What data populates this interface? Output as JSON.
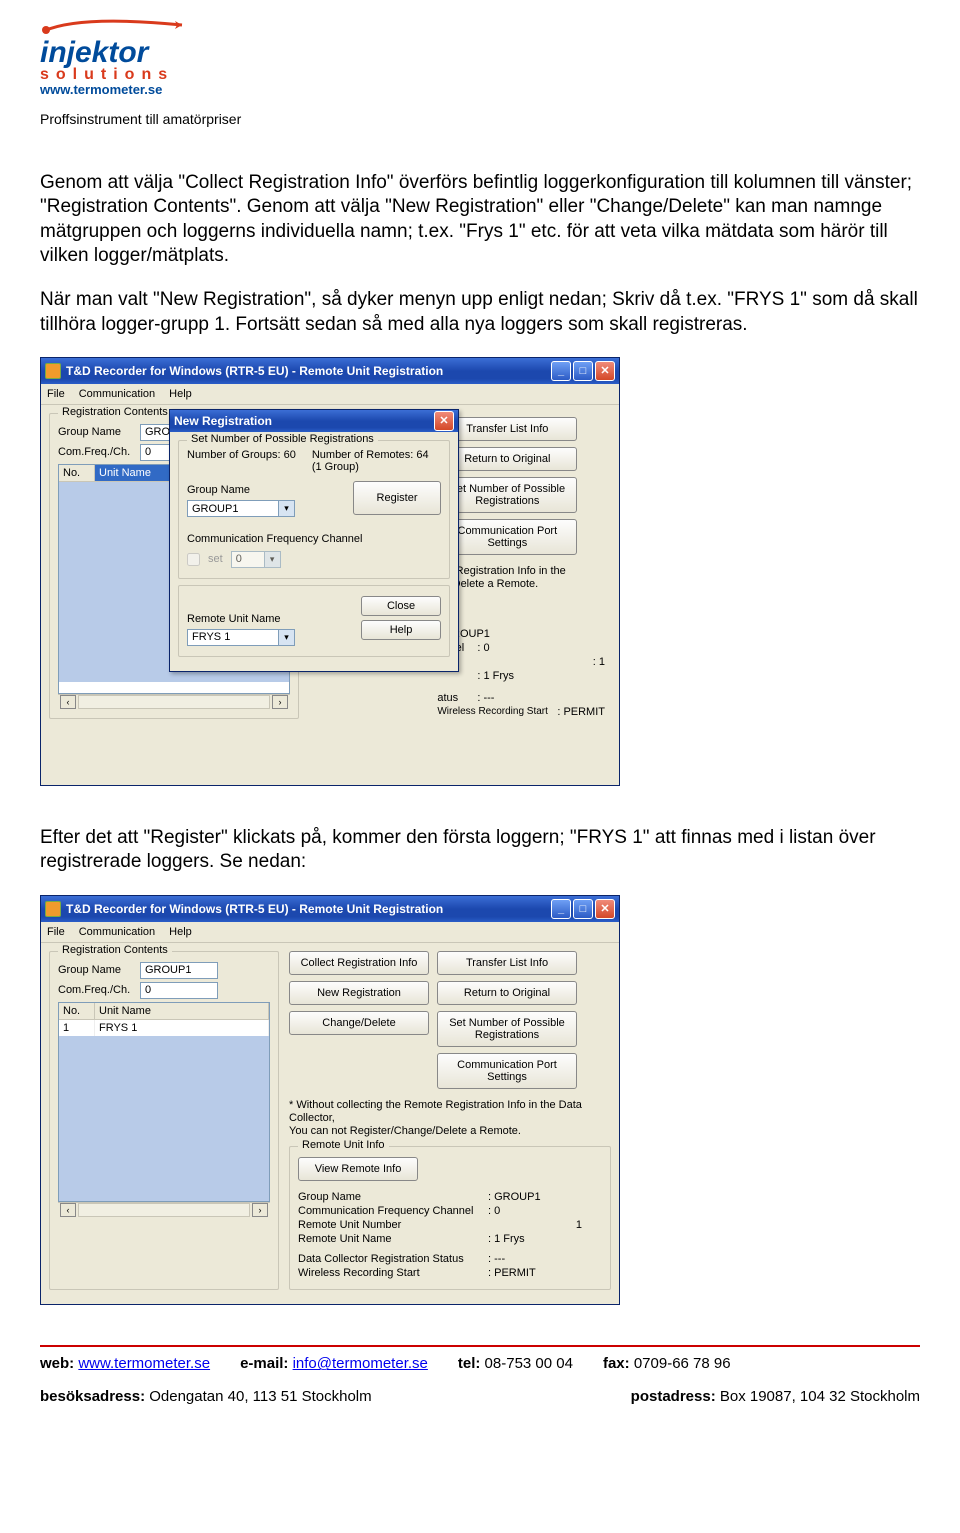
{
  "header": {
    "brand_main": "injektor",
    "brand_sub": "solutions",
    "brand_web": "www.termometer.se",
    "tagline": "Proffsinstrument till amatörpriser"
  },
  "paragraph1": "Genom att välja \"Collect Registration Info\" överförs befintlig loggerkonfiguration till kolumnen till vänster; \"Registration Contents\". Genom att välja \"New Registration\" eller \"Change/Delete\" kan man namnge mätgruppen och loggerns individuella namn; t.ex. \"Frys 1\" etc. för att veta vilka mätdata som härör till vilken logger/mätplats.",
  "paragraph2": "När man valt \"New Registration\", så dyker menyn upp enligt nedan; Skriv då t.ex. \"FRYS 1\" som då skall tillhöra logger-grupp 1. Fortsätt sedan så med alla nya loggers som skall registreras.",
  "paragraph3": "Efter det att \"Register\" klickats på, kommer den första loggern; \"FRYS 1\" att finnas med i listan över registrerade loggers. Se nedan:",
  "win": {
    "title": "T&D Recorder for Windows (RTR-5 EU) - Remote Unit Registration",
    "menu": {
      "file": "File",
      "comm": "Communication",
      "help": "Help"
    },
    "reg_contents": {
      "legend": "Registration Contents",
      "group_name_lbl": "Group Name",
      "group_name_val": "GROUP1",
      "com_freq_lbl": "Com.Freq./Ch.",
      "com_freq_val": "0",
      "col_no": "No.",
      "col_unit": "Unit Name",
      "row1_no": "1",
      "row1_name": "FRYS 1"
    },
    "buttons": {
      "collect": "Collect Registration Info",
      "newreg": "New Registration",
      "change": "Change/Delete",
      "transfer": "Transfer List Info",
      "return": "Return to Original",
      "setnum": "Set Number of Possible Registrations",
      "commport": "Communication Port Settings"
    },
    "note_prefix": "* Without collecting the Remote Registration Info in the Data Collector,",
    "note_body": "You can not Register/Change/Delete a Remote.",
    "note_short_top": "ote Registration Info in the",
    "note_short_bot": "ge/Delete a Remote.",
    "remote_info": {
      "legend": "Remote Unit Info",
      "view_btn": "View Remote Info",
      "group_name_lbl": "Group Name",
      "group_name_val": ": GROUP1",
      "cfc_lbl": "Communication Frequency Channel",
      "cfc_val": ": 0",
      "run_lbl": "Remote Unit Number",
      "run_val": "1",
      "runame_lbl": "Remote Unit Name",
      "runame_val": ": 1 Frys",
      "status_lbl": "Data Collector Registration Status",
      "status_val": ": ---",
      "wrs_lbl": "Wireless Recording Start",
      "wrs_val": ": PERMIT",
      "status_short_lbl": "atus",
      "channel_short_lbl": "annel"
    }
  },
  "dialog": {
    "title": "New Registration",
    "set_num_lbl": "Set Number of Possible Registrations",
    "num_groups_lbl": "Number of Groups: 60",
    "num_remotes_lbl": "Number of Remotes: 64",
    "num_remotes_sub": "(1 Group)",
    "group_name_lbl": "Group Name",
    "group_name_val": "GROUP1",
    "register_btn": "Register",
    "cfc_lbl": "Communication Frequency Channel",
    "set_lbl": "set",
    "cfc_val": "0",
    "remote_unit_lbl": "Remote Unit Name",
    "remote_unit_val": "FRYS 1",
    "close_btn": "Close",
    "help_btn": "Help"
  },
  "footer": {
    "web_lbl": "web:",
    "web_val": "www.termometer.se",
    "email_lbl": "e-mail:",
    "email_val": "info@termometer.se",
    "tel_lbl": "tel:",
    "tel_val": "08-753 00 04",
    "fax_lbl": "fax:",
    "fax_val": "0709-66 78 96",
    "besok_lbl": "besöksadress:",
    "besok_val": "Odengatan 40, 113 51 Stockholm",
    "post_lbl": "postadress:",
    "post_val": "Box 19087, 104 32 Stockholm"
  }
}
